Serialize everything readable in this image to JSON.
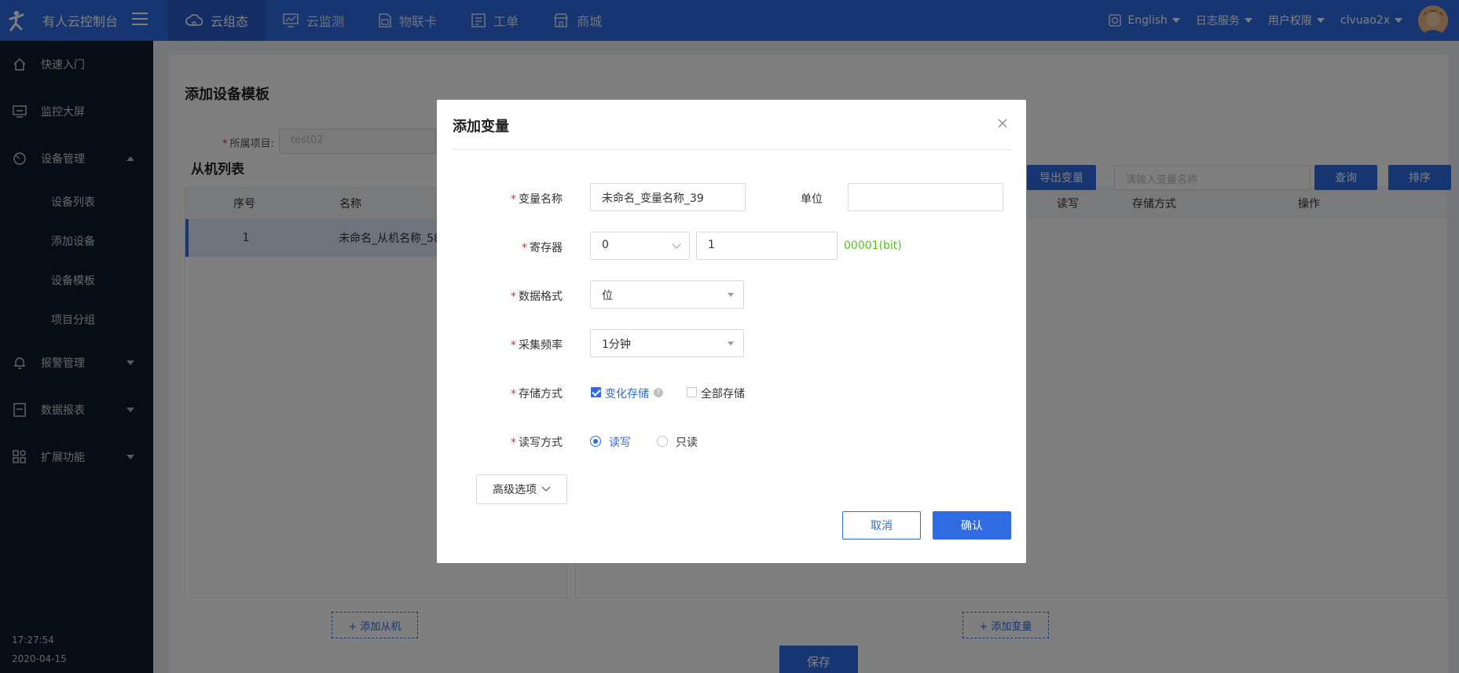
{
  "topbar": {
    "brand_title": "有人云控制台",
    "nav": [
      {
        "label": "云组态",
        "icon": "cloud-icon",
        "active": true
      },
      {
        "label": "云监测",
        "icon": "monitor-chart-icon",
        "active": false
      },
      {
        "label": "物联卡",
        "icon": "sim-card-icon",
        "active": false
      },
      {
        "label": "工单",
        "icon": "ticket-icon",
        "active": false
      },
      {
        "label": "商城",
        "icon": "shop-icon",
        "active": false
      }
    ],
    "language": "English",
    "log_service": "日志服务",
    "user_permission": "用户权限",
    "username": "clvuao2x"
  },
  "sidebar": {
    "items": [
      {
        "label": "快速入门",
        "icon": "home-icon"
      },
      {
        "label": "监控大屏",
        "icon": "screen-icon"
      },
      {
        "label": "设备管理",
        "icon": "device-icon",
        "expanded": true
      }
    ],
    "sub_items": [
      "设备列表",
      "添加设备",
      "设备模板",
      "项目分组"
    ],
    "items_after": [
      {
        "label": "报警管理",
        "icon": "bell-icon"
      },
      {
        "label": "数据报表",
        "icon": "report-icon"
      },
      {
        "label": "扩展功能",
        "icon": "grid-icon"
      }
    ],
    "time": "17:27:54",
    "date": "2020-04-15"
  },
  "main": {
    "title": "添加设备模板",
    "project_label": "所属项目:",
    "project_value": "test02",
    "slave_list_title": "从机列表",
    "slave_table": {
      "headers": [
        "序号",
        "名称"
      ],
      "rows": [
        {
          "index": "1",
          "name": "未命名_从机名称_58"
        }
      ]
    },
    "var_table_headers": [
      "读写",
      "存储方式",
      "操作"
    ],
    "export_button": "导出变量",
    "search_placeholder": "请输入变量名称",
    "query_button": "查询",
    "sort_button": "排序",
    "add_slave_button": "+ 添加从机",
    "add_var_button": "+ 添加变量",
    "save_button": "保存"
  },
  "modal": {
    "title": "添加变量",
    "fields": {
      "name_label": "变量名称",
      "name_value": "未命名_变量名称_39",
      "unit_label": "单位",
      "unit_value": "",
      "register_label": "寄存器",
      "register_type": "0",
      "register_address": "1",
      "register_hint": "00001(bit)",
      "format_label": "数据格式",
      "format_value": "位",
      "freq_label": "采集频率",
      "freq_value": "1分钟",
      "storage_label": "存储方式",
      "storage_change": "变化存储",
      "storage_all": "全部存储",
      "storage_help": "?",
      "rw_label": "读写方式",
      "rw_readwrite": "读写",
      "rw_readonly": "只读"
    },
    "advanced_button": "高级选项",
    "cancel_button": "取消",
    "ok_button": "确认"
  },
  "colors": {
    "primary": "#2f6be3",
    "sidebar_bg": "#0e1a2b",
    "hint_green": "#52c41a"
  }
}
